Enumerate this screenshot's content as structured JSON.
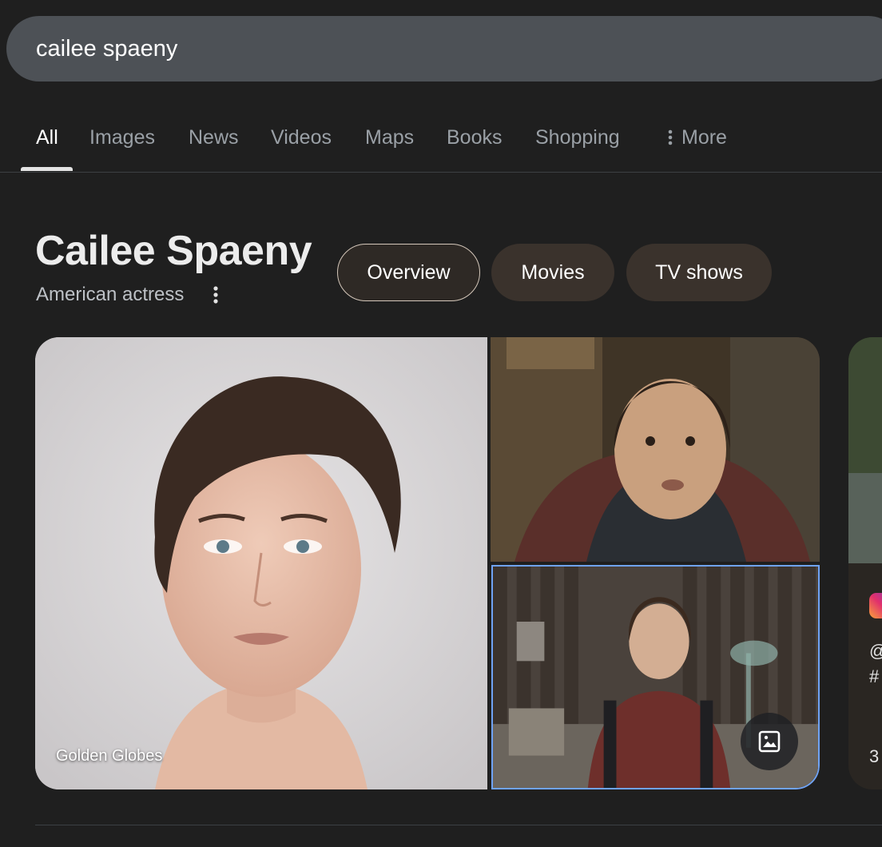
{
  "search": {
    "query": "cailee spaeny"
  },
  "tabs": [
    {
      "label": "All",
      "active": true
    },
    {
      "label": "Images"
    },
    {
      "label": "News"
    },
    {
      "label": "Videos"
    },
    {
      "label": "Maps"
    },
    {
      "label": "Books"
    },
    {
      "label": "Shopping"
    },
    {
      "label": "More"
    }
  ],
  "entity": {
    "title": "Cailee Spaeny",
    "subtitle": "American actress",
    "chips": [
      {
        "label": "Overview",
        "selected": true
      },
      {
        "label": "Movies"
      },
      {
        "label": "TV shows"
      }
    ]
  },
  "images": {
    "main_caption": "Golden Globes"
  },
  "peek_card": {
    "icon": "instagram-icon",
    "line1": "@",
    "line2": "#",
    "line3": "3"
  },
  "colors": {
    "background": "#1f1f1f",
    "search_bar": "#4d5156",
    "chip": "#3a322c",
    "selected_outline": "#6fa3f5"
  }
}
